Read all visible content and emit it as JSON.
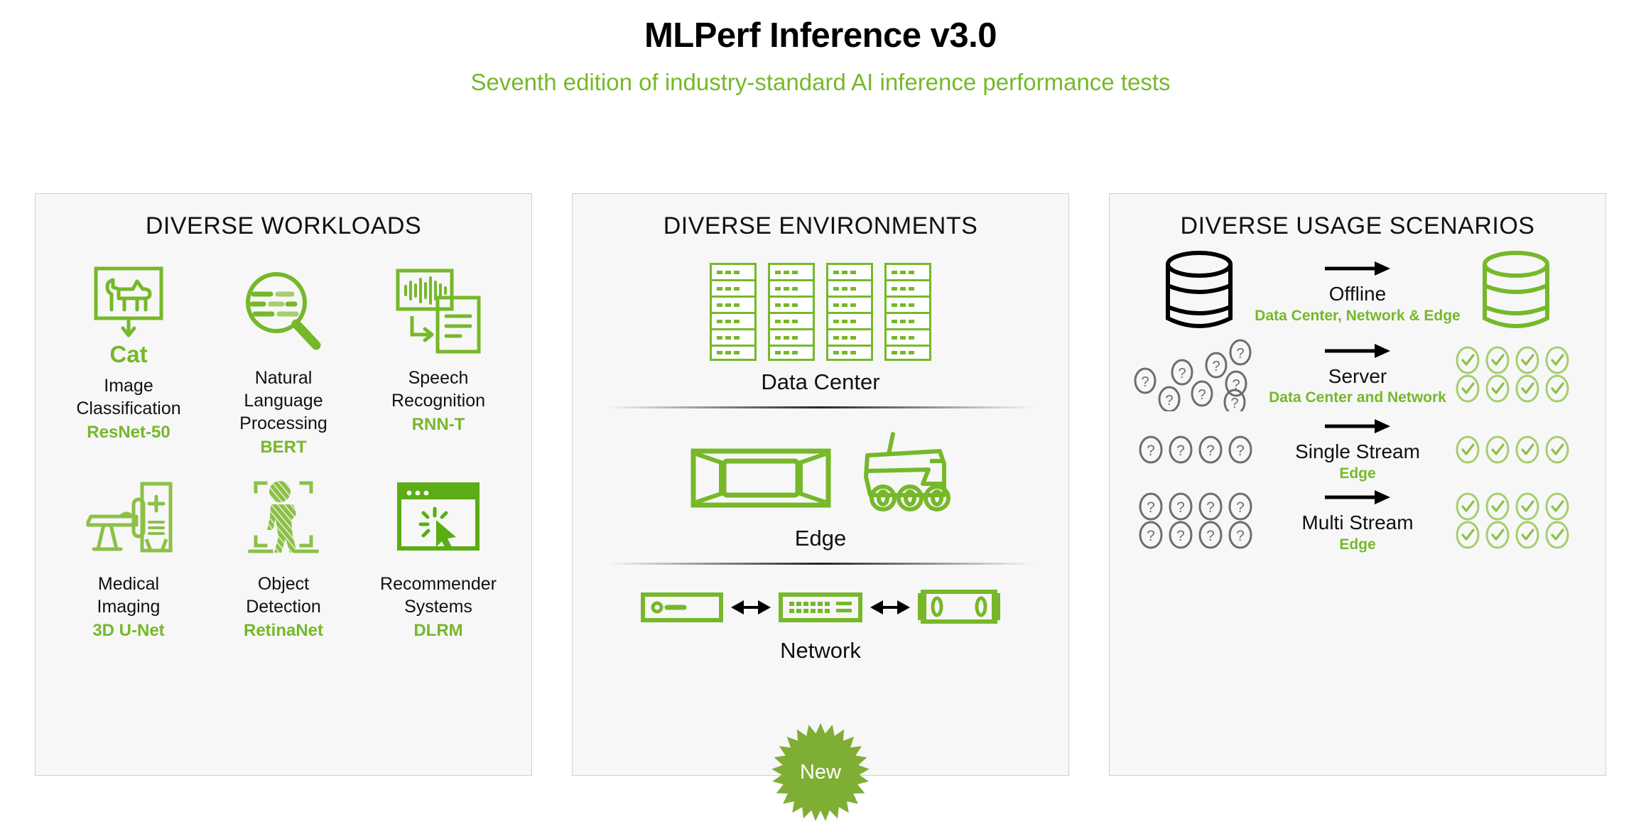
{
  "header": {
    "title": "MLPerf Inference v3.0",
    "subtitle": "Seventh edition of industry-standard AI inference performance tests"
  },
  "colors": {
    "green": "#76b82a",
    "green_light": "#a6ce6e",
    "panel_bg": "#f7f7f7",
    "panel_border": "#cfcfcf",
    "text": "#111111",
    "gray_icon": "#6d6d6d"
  },
  "panels": {
    "workloads": {
      "title": "DIVERSE WORKLOADS",
      "items": [
        {
          "icon": "image-classification-icon",
          "name": "Image\nClassification",
          "name_lines": [
            "Image",
            "Classification"
          ],
          "model": "ResNet-50"
        },
        {
          "icon": "natural-language-processing-icon",
          "name": "Natural Language\nProcessing",
          "name_lines": [
            "Natural Language",
            "Processing"
          ],
          "model": "BERT"
        },
        {
          "icon": "speech-recognition-icon",
          "name": "Speech\nRecognition",
          "name_lines": [
            "Speech",
            "Recognition"
          ],
          "model": "RNN-T"
        },
        {
          "icon": "medical-imaging-icon",
          "name": "Medical\nImaging",
          "name_lines": [
            "Medical",
            "Imaging"
          ],
          "model": "3D U-Net"
        },
        {
          "icon": "object-detection-icon",
          "name": "Object\nDetection",
          "name_lines": [
            "Object",
            "Detection"
          ],
          "model": "RetinaNet"
        },
        {
          "icon": "recommender-systems-icon",
          "name": "Recommender\nSystems",
          "name_lines": [
            "Recommender",
            "Systems"
          ],
          "model": "DLRM"
        }
      ],
      "image_classification_caption": "Cat"
    },
    "environments": {
      "title": "DIVERSE ENVIRONMENTS",
      "items": [
        {
          "label": "Data Center",
          "icon": "server-rack-icon",
          "rack_count": 4,
          "shelves_per_rack": 6
        },
        {
          "label": "Edge",
          "icon": "edge-device-and-vehicle-icon"
        },
        {
          "label": "Network",
          "icon": "network-switch-icon"
        }
      ],
      "badge": "New"
    },
    "scenarios": {
      "title": "DIVERSE USAGE SCENARIOS",
      "items": [
        {
          "name": "Offline",
          "where": "Data Center, Network & Edge",
          "left_icon": "database-stack-icon",
          "right_icon": "database-stack-icon",
          "queries": 0,
          "results": 0
        },
        {
          "name": "Server",
          "where": "Data Center and Network",
          "left_icon": "question-mark-icon",
          "right_icon": "check-circle-icon",
          "queries": 8,
          "results": 8
        },
        {
          "name": "Single Stream",
          "where": "Edge",
          "left_icon": "question-mark-icon",
          "right_icon": "check-circle-icon",
          "queries": 4,
          "results": 4
        },
        {
          "name": "Multi Stream",
          "where": "Edge",
          "left_icon": "question-mark-icon",
          "right_icon": "check-circle-icon",
          "queries": 8,
          "results": 8
        }
      ]
    }
  }
}
